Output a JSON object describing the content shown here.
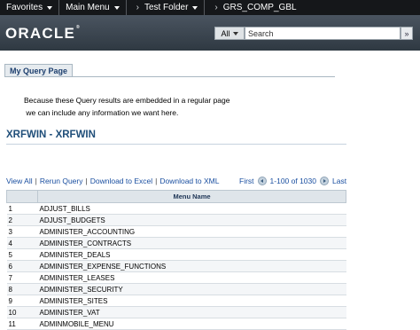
{
  "nav": {
    "favorites": "Favorites",
    "main_menu": "Main Menu",
    "sep": "›",
    "test_folder": "Test Folder",
    "crumb": "GRS_COMP_GBL"
  },
  "brand": {
    "logo": "ORACLE",
    "reg": "®"
  },
  "search": {
    "scope": "All",
    "placeholder": "Search",
    "go": "»"
  },
  "tab": {
    "label": "My Query Page"
  },
  "message": "Because these Query results are embedded in a regular page\n we can include any information we want here.",
  "query_title": "XRFWIN - XRFWIN",
  "links": {
    "view_all": "View All",
    "rerun": "Rerun Query",
    "excel": "Download to Excel",
    "xml": "Download to XML",
    "sep": "|"
  },
  "pager": {
    "first": "First",
    "range": "1-100 of 1030",
    "last": "Last"
  },
  "table": {
    "header": "Menu Name",
    "rows": [
      {
        "n": "1",
        "name": "ADJUST_BILLS"
      },
      {
        "n": "2",
        "name": "ADJUST_BUDGETS"
      },
      {
        "n": "3",
        "name": "ADMINISTER_ACCOUNTING"
      },
      {
        "n": "4",
        "name": "ADMINISTER_CONTRACTS"
      },
      {
        "n": "5",
        "name": "ADMINISTER_DEALS"
      },
      {
        "n": "6",
        "name": "ADMINISTER_EXPENSE_FUNCTIONS"
      },
      {
        "n": "7",
        "name": "ADMINISTER_LEASES"
      },
      {
        "n": "8",
        "name": "ADMINISTER_SECURITY"
      },
      {
        "n": "9",
        "name": "ADMINISTER_SITES"
      },
      {
        "n": "10",
        "name": "ADMINISTER_VAT"
      },
      {
        "n": "11",
        "name": "ADMINMOBILE_MENU"
      }
    ]
  }
}
